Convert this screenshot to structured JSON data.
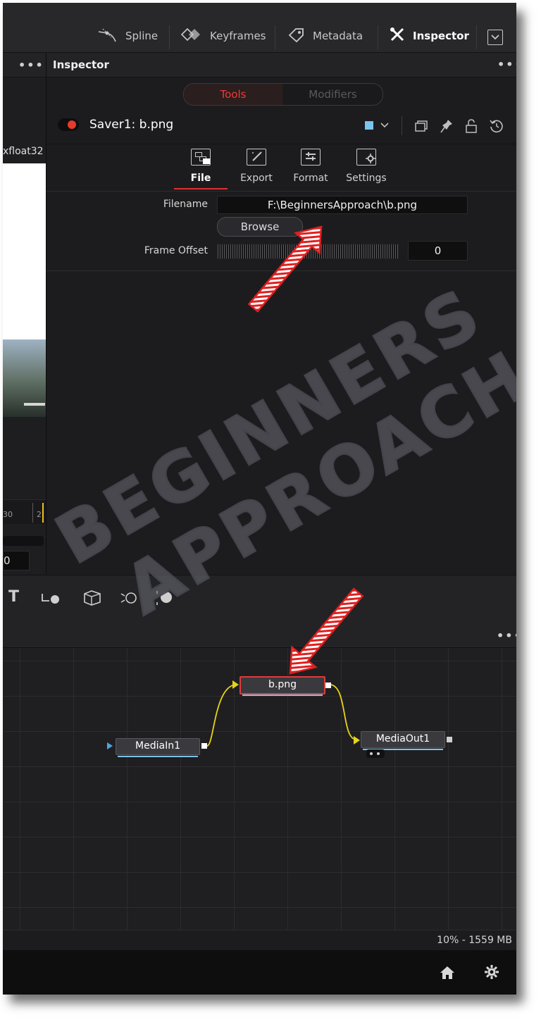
{
  "toolbar": {
    "spline": "Spline",
    "keyframes": "Keyframes",
    "metadata": "Metadata",
    "inspector": "Inspector"
  },
  "panel": {
    "title": "Inspector",
    "tabs": {
      "tools": "Tools",
      "modifiers": "Modifiers"
    },
    "node_title": "Saver1: b.png",
    "subtabs": [
      "File",
      "Export",
      "Format",
      "Settings"
    ],
    "filename_label": "Filename",
    "filename_value": "F:\\BeginnersApproach\\b.png",
    "browse_label": "Browse",
    "frame_offset_label": "Frame Offset",
    "frame_offset_value": "0"
  },
  "viewer": {
    "format_text": "xfloat32",
    "time_a": "30",
    "time_b": "2",
    "time_c": "0"
  },
  "flow": {
    "nodes": {
      "saver": "b.png",
      "media_in": "MediaIn1",
      "media_out": "MediaOut1"
    }
  },
  "status": {
    "memory": "10% - 1559 MB"
  },
  "watermark": {
    "line1": "BEGINNERS",
    "line2": "APPROACH"
  },
  "colors": {
    "accent_red": "#e03030",
    "link_yellow": "#e8d21a",
    "node_blue": "#7fc4e4"
  }
}
